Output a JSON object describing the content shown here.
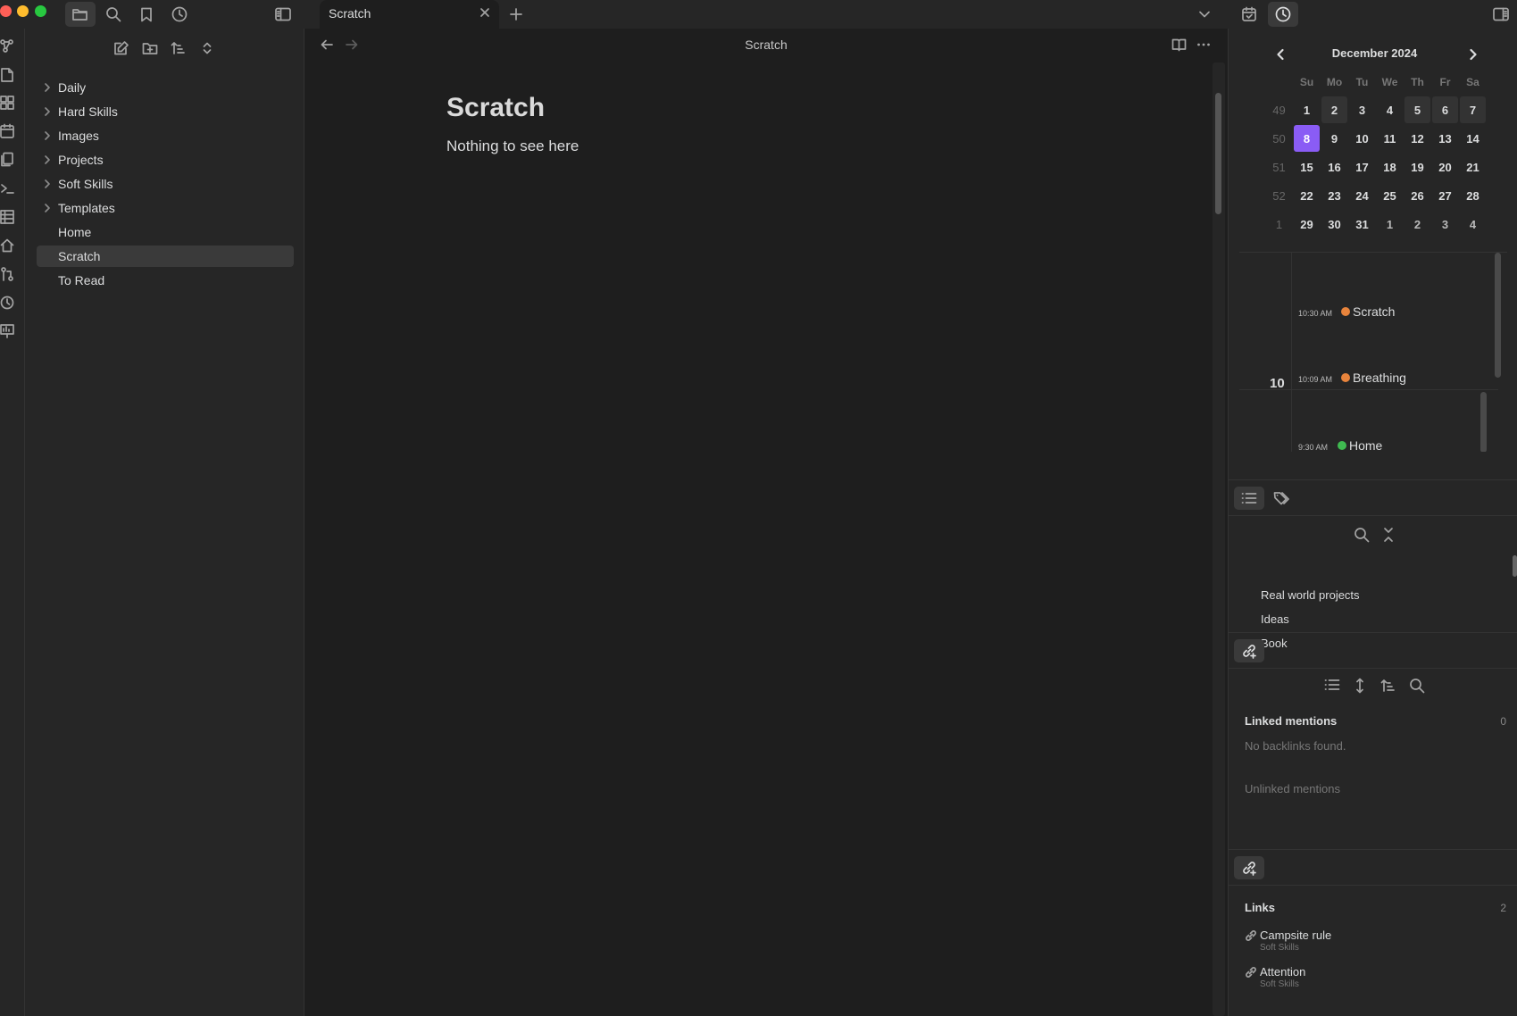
{
  "tab": {
    "title": "Scratch"
  },
  "explorer": {
    "items": [
      {
        "label": "Daily",
        "folder": true
      },
      {
        "label": "Hard Skills",
        "folder": true
      },
      {
        "label": "Images",
        "folder": true
      },
      {
        "label": "Projects",
        "folder": true
      },
      {
        "label": "Soft Skills",
        "folder": true
      },
      {
        "label": "Templates",
        "folder": true
      },
      {
        "label": "Home",
        "folder": false
      },
      {
        "label": "Scratch",
        "folder": false,
        "selected": true
      },
      {
        "label": "To Read",
        "folder": false
      }
    ]
  },
  "editor": {
    "header_title": "Scratch",
    "note_title": "Scratch",
    "note_body": "Nothing to see here"
  },
  "calendar": {
    "month": "December 2024",
    "weekdays": [
      "Su",
      "Mo",
      "Tu",
      "We",
      "Th",
      "Fr",
      "Sa"
    ],
    "weeks": [
      {
        "wk": "49",
        "days": [
          "1",
          "2",
          "3",
          "4",
          "5",
          "6",
          "7"
        ]
      },
      {
        "wk": "50",
        "days": [
          "8",
          "9",
          "10",
          "11",
          "12",
          "13",
          "14"
        ]
      },
      {
        "wk": "51",
        "days": [
          "15",
          "16",
          "17",
          "18",
          "19",
          "20",
          "21"
        ]
      },
      {
        "wk": "52",
        "days": [
          "22",
          "23",
          "24",
          "25",
          "26",
          "27",
          "28"
        ]
      },
      {
        "wk": "1",
        "days": [
          "29",
          "30",
          "31",
          "1",
          "2",
          "3",
          "4"
        ]
      }
    ],
    "today": "8",
    "accent_color": "#8a5cf5"
  },
  "timeline": {
    "hour_label": "10",
    "entries": [
      {
        "time": "10:30 AM",
        "name": "Scratch",
        "color": "#e8843c"
      },
      {
        "time": "10:09 AM",
        "name": "Breathing",
        "color": "#e8843c"
      },
      {
        "time": "9:30 AM",
        "name": "Home",
        "color": "#3fb950"
      }
    ]
  },
  "tags": {
    "items": [
      {
        "label": "Real world projects",
        "expandable": false
      },
      {
        "label": "Ideas",
        "expandable": false
      },
      {
        "label": "Book",
        "expandable": true
      }
    ]
  },
  "backlinks": {
    "linked_title": "Linked mentions",
    "linked_count": "0",
    "linked_empty": "No backlinks found.",
    "unlinked_title": "Unlinked mentions"
  },
  "outgoing": {
    "title": "Links",
    "count": "2",
    "items": [
      {
        "name": "Campsite rule",
        "path": "Soft Skills"
      },
      {
        "name": "Attention",
        "path": "Soft Skills"
      }
    ]
  }
}
